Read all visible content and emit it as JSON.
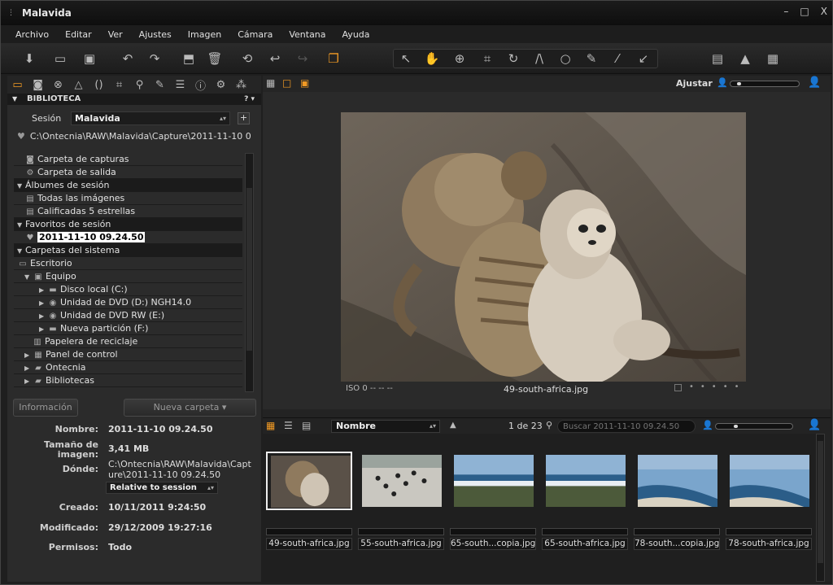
{
  "window": {
    "title": "Malavida",
    "min": "–",
    "max": "□",
    "close": "X"
  },
  "menu": [
    "Archivo",
    "Editar",
    "Ver",
    "Ajustes",
    "Imagen",
    "Cámara",
    "Ventana",
    "Ayuda"
  ],
  "library": {
    "section": "BIBLIOTECA",
    "help": "?",
    "session_label": "Sesión",
    "session_value": "Malavida",
    "add": "+",
    "path": "C:\\Ontecnia\\RAW\\Malavida\\Capture\\2011-11-10 0",
    "tree": [
      {
        "label": "Carpeta de capturas",
        "indent": 1,
        "icon": "camera-icon",
        "hdr": false
      },
      {
        "label": "Carpeta de salida",
        "indent": 1,
        "icon": "gear-icon",
        "hdr": false
      },
      {
        "label": "Álbumes de sesión",
        "indent": 0,
        "icon": "",
        "hdr": true
      },
      {
        "label": "Todas las imágenes",
        "indent": 1,
        "icon": "images-icon",
        "hdr": false
      },
      {
        "label": "Calificadas 5 estrellas",
        "indent": 1,
        "icon": "images-icon",
        "hdr": false
      },
      {
        "label": "Favoritos de sesión",
        "indent": 0,
        "icon": "",
        "hdr": true
      },
      {
        "label": "2011-11-10 09.24.50",
        "indent": 1,
        "icon": "heart-icon",
        "hdr": false,
        "highlight": true
      },
      {
        "label": "Carpetas del sistema",
        "indent": 0,
        "icon": "",
        "hdr": true
      },
      {
        "label": "Escritorio",
        "indent": 0,
        "icon": "desktop-icon",
        "hdr": false
      },
      {
        "label": "Equipo",
        "indent": 1,
        "icon": "computer-icon",
        "hdr": false,
        "expand": "open"
      },
      {
        "label": "Disco local (C:)",
        "indent": 3,
        "icon": "drive-icon",
        "hdr": false,
        "expand": "closed"
      },
      {
        "label": "Unidad de DVD (D:) NGH14.0",
        "indent": 3,
        "icon": "dvd-icon",
        "hdr": false,
        "expand": "closed"
      },
      {
        "label": "Unidad de DVD RW (E:)",
        "indent": 3,
        "icon": "dvd-icon",
        "hdr": false,
        "expand": "closed"
      },
      {
        "label": "Nueva partición (F:)",
        "indent": 3,
        "icon": "drive-icon",
        "hdr": false,
        "expand": "closed"
      },
      {
        "label": "Papelera de reciclaje",
        "indent": 2,
        "icon": "trash-icon",
        "hdr": false
      },
      {
        "label": "Panel de control",
        "indent": 1,
        "icon": "panel-icon",
        "hdr": false,
        "expand": "closed"
      },
      {
        "label": "Ontecnia",
        "indent": 1,
        "icon": "folder-icon",
        "hdr": false,
        "expand": "closed"
      },
      {
        "label": "Bibliotecas",
        "indent": 1,
        "icon": "folder-icon",
        "hdr": false,
        "expand": "closed"
      }
    ],
    "info_button": "Información",
    "new_folder_button": "Nueva carpeta ▾",
    "info": {
      "name_k": "Nombre:",
      "name_v": "2011-11-10 09.24.50",
      "size_k1": "Tamaño de",
      "size_k2": "imagen:",
      "size_v": "3,41 MB",
      "where_k": "Dónde:",
      "where_v1": "C:\\Ontecnia\\RAW\\Malavida\\Capt",
      "where_v2": "ure\\2011-11-10 09.24.50",
      "relative": "Relative to session",
      "created_k": "Creado:",
      "created_v": "10/11/2011 9:24:50",
      "modified_k": "Modificado:",
      "modified_v": "29/12/2009 19:27:16",
      "perm_k": "Permisos:",
      "perm_v": "Todo"
    }
  },
  "viewer": {
    "adjust": "Ajustar",
    "iso": "ISO 0 -- -- --",
    "filename": "49-south-africa.jpg"
  },
  "browser": {
    "sort": "Nombre",
    "count": "1 de 23",
    "search_placeholder": "Buscar 2011-11-10 09.24.50"
  },
  "thumbnails": [
    {
      "name": "49-south-africa.jpg",
      "selected": true,
      "kind": "meerkat"
    },
    {
      "name": "55-south-africa.jpg",
      "selected": false,
      "kind": "penguin"
    },
    {
      "name": "65-south...copia.jpg",
      "selected": false,
      "kind": "coast"
    },
    {
      "name": "65-south-africa.jpg",
      "selected": false,
      "kind": "coast"
    },
    {
      "name": "78-south...copia.jpg",
      "selected": false,
      "kind": "beach"
    },
    {
      "name": "78-south-africa.jpg",
      "selected": false,
      "kind": "beach"
    }
  ],
  "colors": {
    "accent": "#f19a24",
    "bg": "#1f1f1f",
    "panel": "#2b2b2b"
  }
}
